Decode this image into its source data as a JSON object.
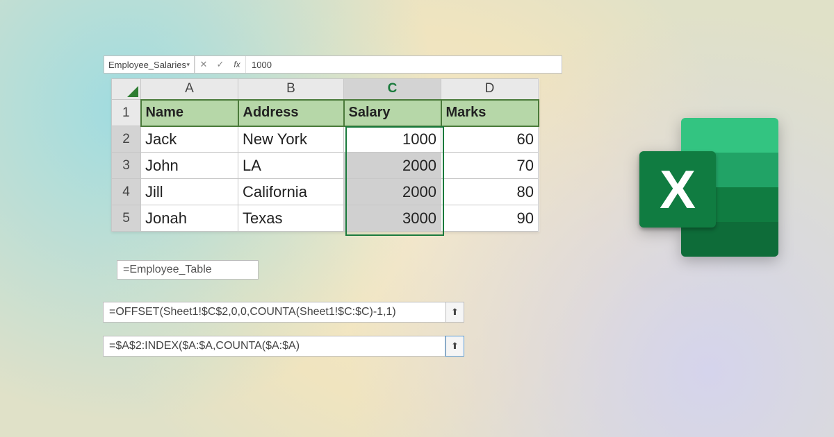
{
  "formula_bar": {
    "name_box": "Employee_Salaries",
    "value": "1000",
    "fx_label": "fx"
  },
  "columns": [
    "A",
    "B",
    "C",
    "D"
  ],
  "row_numbers": [
    "1",
    "2",
    "3",
    "4",
    "5"
  ],
  "headers": {
    "A": "Name",
    "B": "Address",
    "C": "Salary",
    "D": "Marks"
  },
  "rows": [
    {
      "A": "Jack",
      "B": "New York",
      "C": "1000",
      "D": "60"
    },
    {
      "A": "John",
      "B": "LA",
      "C": "2000",
      "D": "70"
    },
    {
      "A": "Jill",
      "B": "California",
      "C": "2000",
      "D": "80"
    },
    {
      "A": "Jonah",
      "B": "Texas",
      "C": "3000",
      "D": "90"
    }
  ],
  "formulas": {
    "table_ref": "=Employee_Table",
    "offset": "=OFFSET(Sheet1!$C$2,0,0,COUNTA(Sheet1!$C:$C)-1,1)",
    "index": "=$A$2:INDEX($A:$A,COUNTA($A:$A)"
  },
  "logo_letter": "X"
}
